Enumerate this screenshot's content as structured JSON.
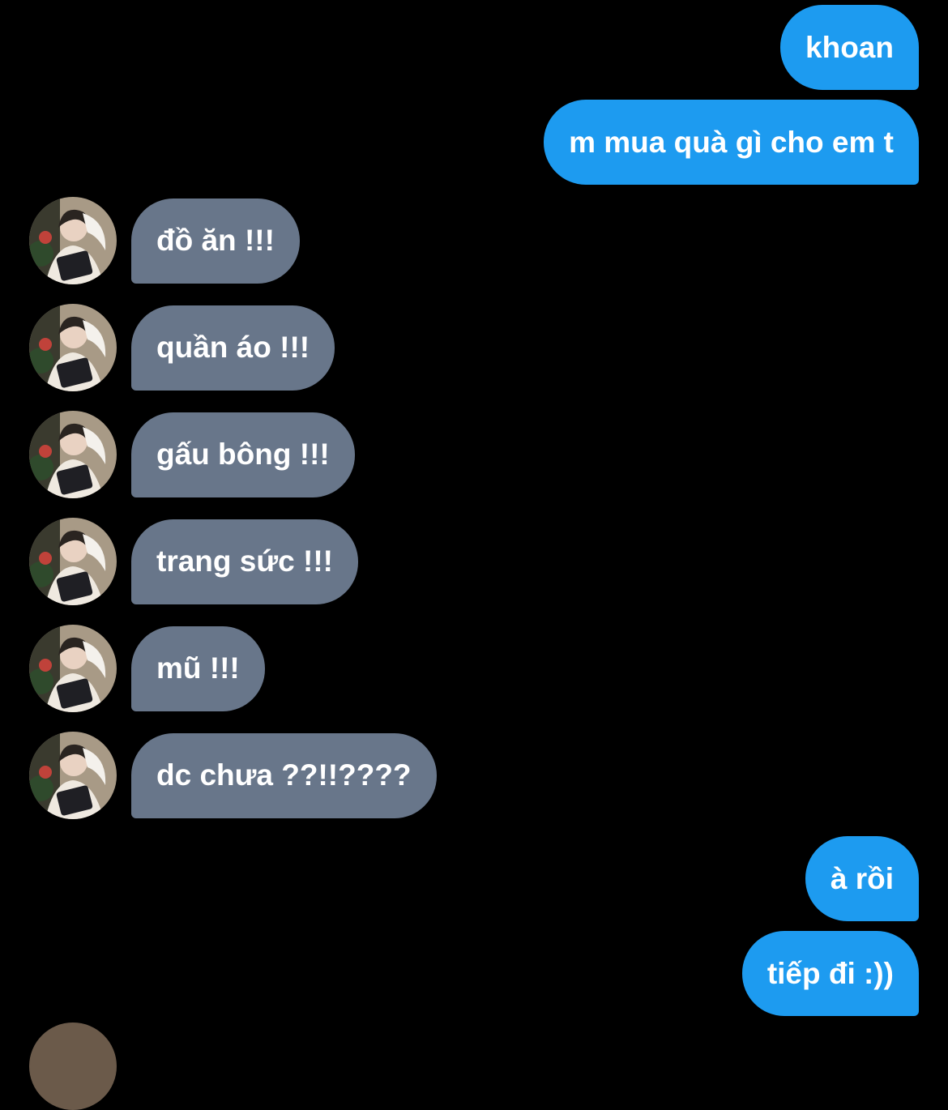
{
  "colors": {
    "background": "#000000",
    "outgoing_bubble": "#1d9bf0",
    "incoming_bubble": "#68768a",
    "text": "#ffffff"
  },
  "messages": [
    {
      "direction": "outgoing",
      "text": "khoan"
    },
    {
      "direction": "outgoing",
      "text": "m mua quà gì cho em t"
    },
    {
      "direction": "incoming",
      "text": "đồ ăn !!!"
    },
    {
      "direction": "incoming",
      "text": "quần áo !!!"
    },
    {
      "direction": "incoming",
      "text": "gấu bông !!!"
    },
    {
      "direction": "incoming",
      "text": "trang sức !!!"
    },
    {
      "direction": "incoming",
      "text": "mũ !!!"
    },
    {
      "direction": "incoming",
      "text": "dc chưa ??!!????"
    },
    {
      "direction": "outgoing",
      "text": "à rồi"
    },
    {
      "direction": "outgoing",
      "text": "tiếp đi :))"
    }
  ],
  "avatar": {
    "icon": "profile-photo-avatar"
  }
}
